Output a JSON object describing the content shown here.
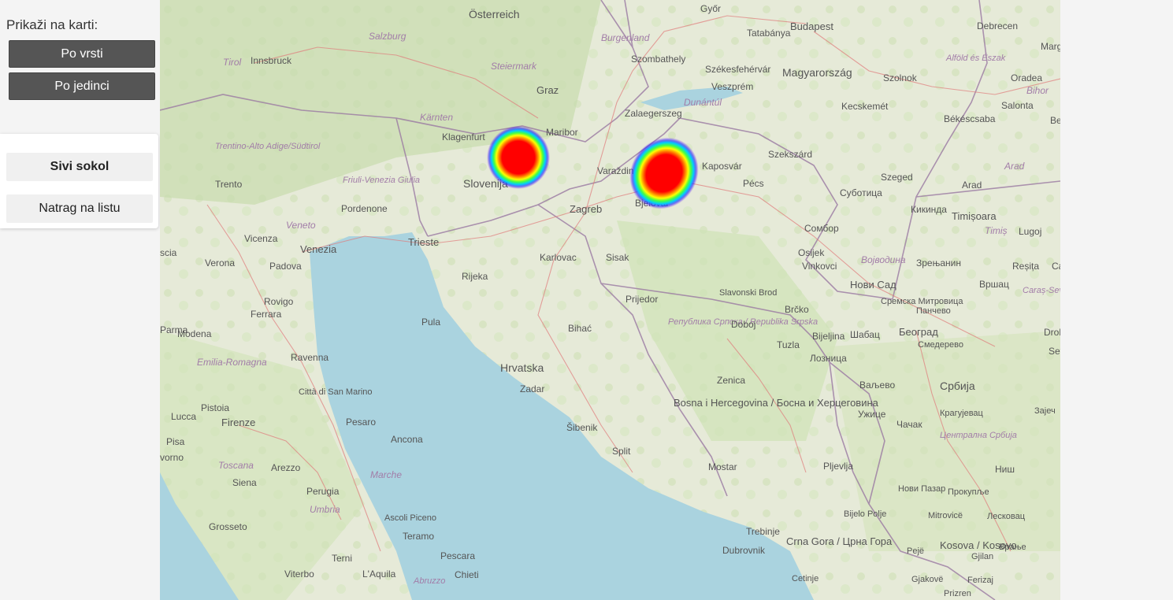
{
  "sidebar": {
    "show_label": "Prikaži na karti:",
    "btn_by_type": "Po vrsti",
    "btn_by_unit": "Po jedinci",
    "species_name": "Sivi sokol",
    "back_label": "Natrag na listu"
  },
  "map": {
    "labels": {
      "osterreich": "Österreich",
      "salzburg": "Salzburg",
      "steiermark": "Steiermark",
      "burgenland": "Burgenland",
      "gyor": "Győr",
      "tatabanya": "Tatabánya",
      "budapest": "Budapest",
      "debrecen": "Debrecen",
      "tirol": "Tirol",
      "innsbruck": "Innsbruck",
      "szombathely": "Szombathely",
      "szekesfehervar": "Székesfehérvár",
      "magyarorszag": "Magyarország",
      "szolnok": "Szolnok",
      "oradea": "Oradea",
      "alfold": "Alföld és Észak",
      "graz": "Graz",
      "veszprem": "Veszprém",
      "dunantul": "Dunántúl",
      "kecskemet": "Kecskemét",
      "salonta": "Salonta",
      "bihor": "Bihor",
      "karnten": "Kärnten",
      "zalaegerszeg": "Zalaegerszeg",
      "bekescsaba": "Békéscsaba",
      "klagenfurt": "Klagenfurt",
      "maribor": "Maribor",
      "trentino": "Trentino-Alto Adige/Südtirol",
      "szekszard": "Szekszárd",
      "varazdin": "Varaždin",
      "kaposvar": "Kaposvár",
      "szeged": "Szeged",
      "arad_reg": "Arad",
      "friuli": "Friuli-Venezia Giulia",
      "slovenija": "Slovenija",
      "pecs": "Pécs",
      "subotica": "Суботица",
      "arad": "Arad",
      "trento": "Trento",
      "pordenone": "Pordenone",
      "zagreb": "Zagreb",
      "bjelovar": "Bjelovar",
      "kikinda": "Кикинда",
      "timisoara": "Timișoara",
      "veneto": "Veneto",
      "timis": "Timiș",
      "lugoj": "Lugoj",
      "sombor": "Сомбор",
      "vicenza": "Vicenza",
      "venezia": "Venezia",
      "trieste": "Trieste",
      "karlovac": "Karlovac",
      "sisak": "Sisak",
      "osijek": "Osijek",
      "vojvodina": "Војводина",
      "zrenjanin": "Зрењанин",
      "resita": "Reșița",
      "verona": "Verona",
      "padova": "Padova",
      "rijeka": "Rijeka",
      "vinkovci": "Vinkovci",
      "novisad": "Нови Сад",
      "vrsac": "Вршац",
      "caras": "Caraș-Severin",
      "prijedor": "Prijedor",
      "slavonski": "Slavonski Brod",
      "sremska": "Сремска Митровица",
      "pancevo": "Панчево",
      "rovigo": "Rovigo",
      "ferrara": "Ferrara",
      "pula": "Pula",
      "brcko": "Brčko",
      "bihac": "Bihać",
      "republika": "Република Српска / Republika Srpska",
      "doboj": "Doboj",
      "modena": "Modena",
      "bijeljina": "Bijeljina",
      "sabac": "Шабац",
      "beograd": "Београд",
      "tuzla": "Tuzla",
      "smederevo": "Смедерево",
      "loznica": "Лозница",
      "ravenna": "Ravenna",
      "emilia": "Emilia-Romagna",
      "hrvatska": "Hrvatska",
      "zenica": "Zenica",
      "valjevo": "Ваљево",
      "srbija": "Србија",
      "zadar": "Zadar",
      "sanmarino": "Città di San Marino",
      "pesaro": "Pesaro",
      "bosna": "Bosna i Hercegovina / Босна и Херцеговина",
      "uzice": "Ужице",
      "kragujevac": "Крагујевац",
      "pistoia": "Pistoia",
      "lucca": "Lucca",
      "firenze": "Firenze",
      "ancona": "Ancona",
      "sibenik": "Šibenik",
      "cacak": "Чачак",
      "centralna": "Централна Србија",
      "pisa": "Pisa",
      "split": "Split",
      "toscana": "Toscana",
      "arezzo": "Arezzo",
      "marche": "Marche",
      "mostar": "Mostar",
      "pljevlja": "Pljevlja",
      "nis": "Ниш",
      "siena": "Siena",
      "perugia": "Perugia",
      "umbria": "Umbria",
      "novipazar": "Нови Пазар",
      "prokuplje": "Прокупље",
      "ascoli": "Ascoli Piceno",
      "bijelopolje": "Bijelo Polje",
      "mitrovice": "Mitrovicë",
      "leskovac": "Лесковац",
      "grosseto": "Grosseto",
      "teramo": "Teramo",
      "trebinje": "Trebinje",
      "crnagora": "Crna Gora / Црна Гора",
      "kosova": "Kosova / Kosovo",
      "vranje": "Врање",
      "dubrovnik": "Dubrovnik",
      "terni": "Terni",
      "pescara": "Pescara",
      "peje": "Pejë",
      "gjilan": "Gjilan",
      "viterbo": "Viterbo",
      "laquila": "L'Aquila",
      "abruzzo": "Abruzzo",
      "chieti": "Chieti",
      "cetinje": "Cetinje",
      "gjakove": "Gjakovë",
      "ferizaj": "Ferizaj",
      "prizren": "Prizren",
      "parma": "Parma",
      "scia": "scia",
      "margitta": "Marg",
      "bei": "Bei",
      "drob": "Drob",
      "seve": "Sev",
      "zajec": "Зајеч",
      "ca": "Ca",
      "livorno": "vorno"
    }
  }
}
